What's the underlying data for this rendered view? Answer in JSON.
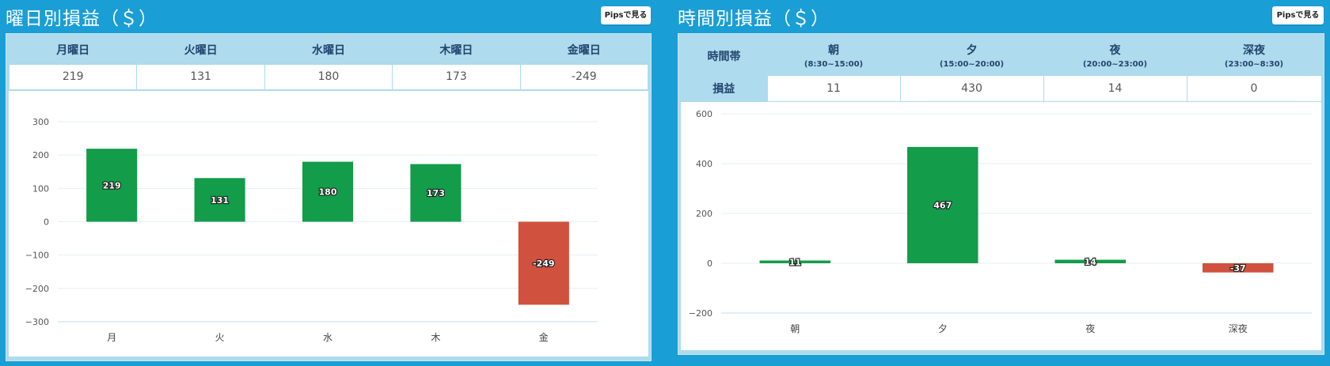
{
  "weekday": {
    "title": "曜日別損益（＄）",
    "pips_button": "Pipsで見る",
    "headers": [
      "月曜日",
      "火曜日",
      "水曜日",
      "木曜日",
      "金曜日"
    ],
    "values": [
      "219",
      "131",
      "180",
      "173",
      "-249"
    ]
  },
  "hourly": {
    "title": "時間別損益（＄）",
    "pips_button": "Pipsで見る",
    "corner_label": "時間帯",
    "row_label": "損益",
    "headers": [
      {
        "name": "朝",
        "range": "(8:30~15:00)"
      },
      {
        "name": "夕",
        "range": "(15:00~20:00)"
      },
      {
        "name": "夜",
        "range": "(20:00~23:00)"
      },
      {
        "name": "深夜",
        "range": "(23:00~8:30)"
      }
    ],
    "values": [
      "11",
      "430",
      "14",
      "0"
    ]
  },
  "colors": {
    "positive": "#139c4a",
    "negative": "#d0513d",
    "accent": "#1a9ed6"
  },
  "chart_data": [
    {
      "type": "bar",
      "categories": [
        "月",
        "火",
        "水",
        "木",
        "金"
      ],
      "values": [
        219,
        131,
        180,
        173,
        -249
      ],
      "data_labels": [
        "219",
        "131",
        "180",
        "173",
        "-249"
      ],
      "ylim": [
        -300,
        300
      ],
      "yticks": [
        300,
        200,
        100,
        0,
        -100,
        -200,
        -300
      ],
      "ytick_labels": [
        "300",
        "200",
        "100",
        "0",
        "−100",
        "−200",
        "−300"
      ],
      "grid": true
    },
    {
      "type": "bar",
      "categories": [
        "朝",
        "夕",
        "夜",
        "深夜"
      ],
      "values": [
        11,
        467,
        14,
        -37
      ],
      "data_labels": [
        "11",
        "467",
        "14",
        "-37"
      ],
      "ylim": [
        -200,
        600
      ],
      "yticks": [
        600,
        400,
        200,
        0,
        -200
      ],
      "ytick_labels": [
        "600",
        "400",
        "200",
        "0",
        "−200"
      ],
      "grid": true
    }
  ]
}
